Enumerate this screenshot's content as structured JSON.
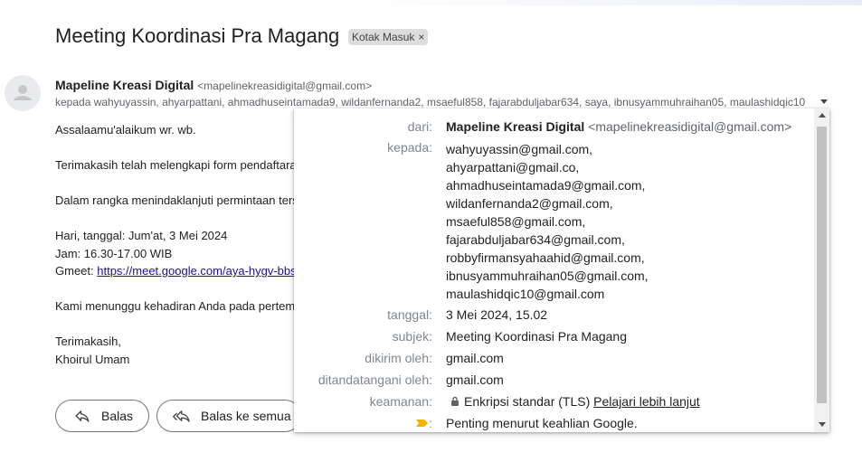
{
  "email": {
    "subject": "Meeting Koordinasi Pra Magang",
    "label_chip": "Kotak Masuk",
    "label_chip_close": "×",
    "sender_name": "Mapeline Kreasi Digital",
    "sender_email": "<mapelinekreasidigital@gmail.com>",
    "to_line": "kepada wahyuyassin, ahyarpattani, ahmadhuseintamada9, wildanfernanda2, msaeful858, fajarabduljabar634, saya, ibnusyammuhraihan05, maulashidqic10",
    "body": {
      "greeting": "Assalaamu'alaikum wr. wb.",
      "line1": "Terimakasih telah melengkapi form pendaftara",
      "line2": "Dalam rangka menindaklanjuti permintaan ters",
      "date_line": "Hari, tanggal: Jum'at, 3 Mei 2024",
      "time_line": "Jam: 16.30-17.00 WIB",
      "gmeet_label": "Gmeet: ",
      "gmeet_link": "https://meet.google.com/aya-hygv-bbs",
      "closing_line": "Kami menunggu kehadiran Anda pada pertem",
      "thanks": "Terimakasih,",
      "signature": "Khoirul Umam"
    },
    "buttons": {
      "reply": "Balas",
      "reply_all": "Balas ke semua"
    }
  },
  "details_popup": {
    "from_label": "dari:",
    "from_name": "Mapeline Kreasi Digital",
    "from_email": "<mapelinekreasidigital@gmail.com>",
    "to_label": "kepada:",
    "recipients": [
      "wahyuyassin@gmail.com,",
      "ahyarpattani@gmail.co,",
      "ahmadhuseintamada9@gmail.com,",
      "wildanfernanda2@gmail.com,",
      "msaeful858@gmail.com,",
      "fajarabduljabar634@gmail.com,",
      "robbyfirmansyahaahid@gmail.com,",
      "ibnusyammuhraihan05@gmail.com,",
      "maulashidqic10@gmail.com"
    ],
    "date_label": "tanggal:",
    "date_value": "3 Mei 2024, 15.02",
    "subject_label": "subjek:",
    "subject_value": "Meeting Koordinasi Pra Magang",
    "mailed_by_label": "dikirim oleh:",
    "mailed_by_value": "gmail.com",
    "signed_by_label": "ditandatangani oleh:",
    "signed_by_value": "gmail.com",
    "security_label": "keamanan:",
    "security_value": "Enkripsi standar (TLS)",
    "security_link": "Pelajari lebih lanjut",
    "importance_label": ":",
    "importance_value": "Penting menurut keahlian Google.",
    "icons": {
      "lock": "lock-icon",
      "importance": "importance-marker-icon",
      "importance_color": "#f4b400"
    }
  }
}
